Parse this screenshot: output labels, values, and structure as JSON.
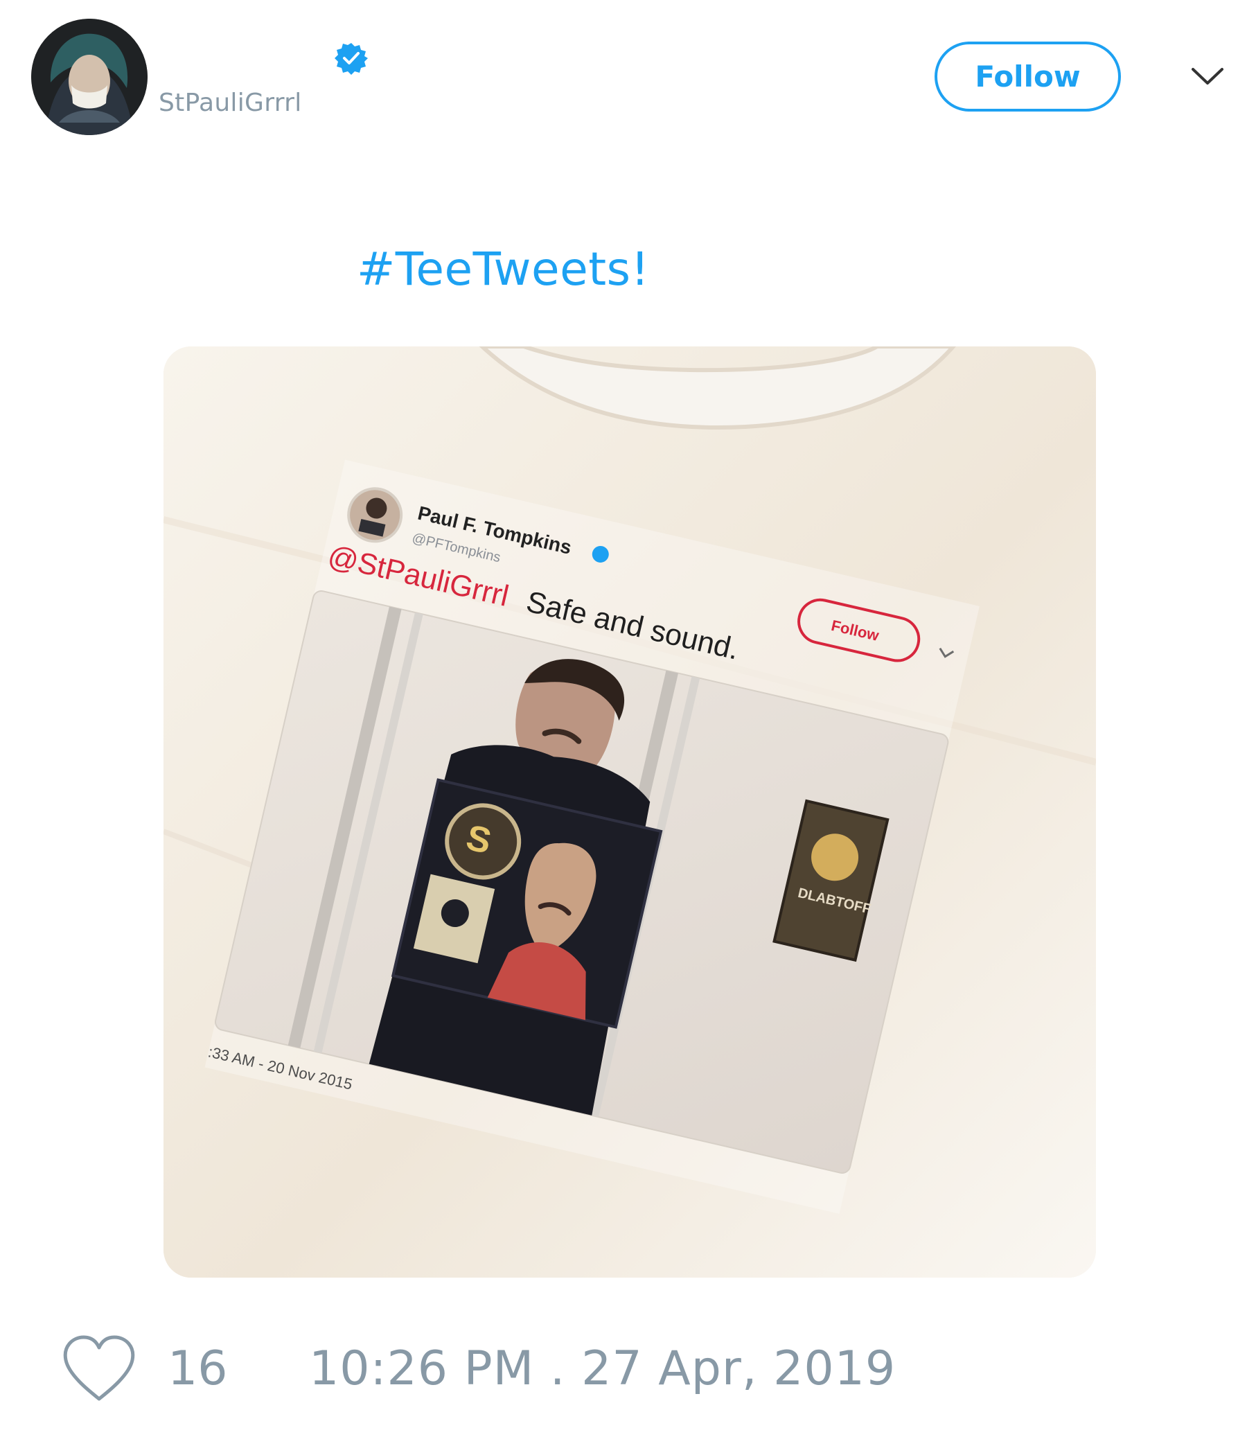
{
  "header": {
    "username": "StPauliGrrrl",
    "follow_label": "Follow",
    "avatar_icon": "profile-avatar",
    "verified_icon": "verified-badge-icon",
    "menu_icon": "chevron-down-icon"
  },
  "tweet": {
    "text": "#TeeTweets!",
    "media": {
      "shirt_print": {
        "author_name": "Paul F. Tompkins",
        "author_handle": "@PFTompkins",
        "mention": "@StPauliGrrrl",
        "body": "Safe and sound.",
        "follow_label": "Follow",
        "timestamp": ":33 AM - 20 Nov 2015"
      }
    }
  },
  "footer": {
    "like_count": "16",
    "timestamp": "10:26 PM . 27 Apr, 2019",
    "like_icon": "heart-icon"
  },
  "colors": {
    "accent": "#1da1f2",
    "muted": "#8899a6",
    "shirt": "#f4efe6",
    "print_red": "#d7263d"
  }
}
